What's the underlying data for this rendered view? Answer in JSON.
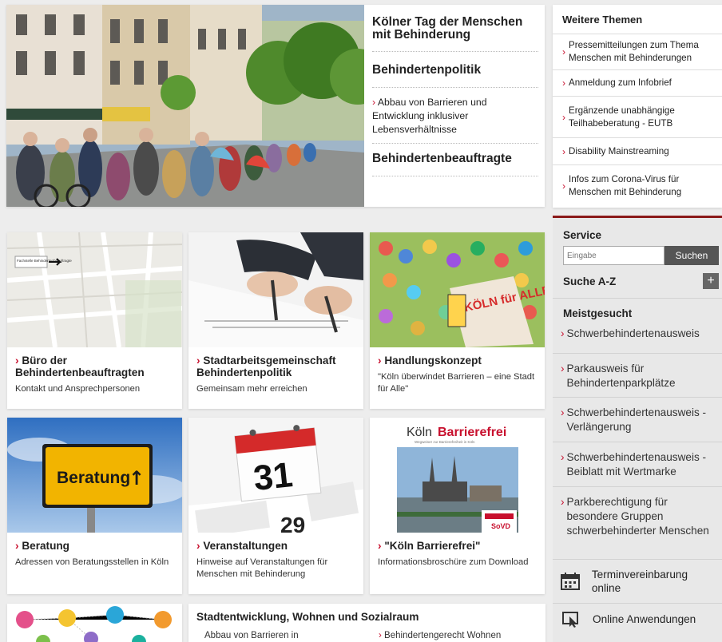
{
  "hero": {
    "title": "Kölner Tag der Menschen mit Behinderung",
    "section1": "Behindertenpolitik",
    "link1": "Abbau von Barrieren und Entwicklung inklusiver Lebensverhältnisse",
    "section2": "Behindertenbeauftragte"
  },
  "weitere": {
    "heading": "Weitere Themen",
    "items": [
      "Pressemitteilungen zum Thema Menschen mit Behinderungen",
      "Anmeldung zum Infobrief",
      "Ergänzende unabhängige Teilhabeberatung - EUTB",
      "Disability Mainstreaming",
      "Infos zum Corona-Virus für Menschen mit Behinderung"
    ]
  },
  "service": {
    "title": "Service",
    "search_placeholder": "Eingabe",
    "search_button": "Suchen",
    "az_label": "Suche A-Z",
    "az_toggle": "+",
    "meist_title": "Meistgesucht",
    "meist_items": [
      "Schwerbehindertenausweis",
      "Parkausweis für Behindertenparkplätze",
      "Schwerbehindertenausweis - Verlängerung",
      "Schwerbehindertenausweis - Beiblatt mit Wertmarke",
      "Parkberechtigung für besondere Gruppen schwerbehinderter Menschen"
    ],
    "tool1": "Terminvereinbarung online",
    "tool2": "Online Anwendungen"
  },
  "tiles": [
    {
      "title": "Büro der Behindertenbeauftragten",
      "desc": "Kontakt und Ansprechpersonen",
      "image_text": "Fachstelle Behindertenbeauftragte"
    },
    {
      "title": "Stadtarbeitsgemeinschaft Behindertenpolitik",
      "desc": "Gemeinsam mehr erreichen"
    },
    {
      "title": "Handlungskonzept",
      "desc": "\"Köln überwindet Barrieren – eine Stadt für Alle\"",
      "image_text": "KÖLN für ALLE STADT"
    },
    {
      "title": "Beratung",
      "desc": "Adressen von Beratungsstellen in Köln",
      "sign": "Beratung",
      "sign_arrow": "↑"
    },
    {
      "title": "Veranstaltungen",
      "desc": "Hinweise auf Veranstaltungen für Menschen mit Behinderung",
      "cal_day": "31",
      "cal_next": "29"
    },
    {
      "title": "\"Köln Barrierefrei\"",
      "desc": "Informationsbroschüre zum Download",
      "cover_a": "Köln",
      "cover_b": "Barrierefrei",
      "cover_sub": "Wegweiser zur Barrierefreiheit in Köln",
      "cover_logo": "SoVD"
    }
  ],
  "bottom": {
    "title": "Stadtentwicklung, Wohnen und Sozialraum",
    "item1": "Abbau von Barrieren in",
    "item2": "Behindertengerecht Wohnen"
  },
  "colors": {
    "accent": "#c8102e",
    "sidebar_border": "#8b1a1a",
    "search_button": "#555555"
  }
}
